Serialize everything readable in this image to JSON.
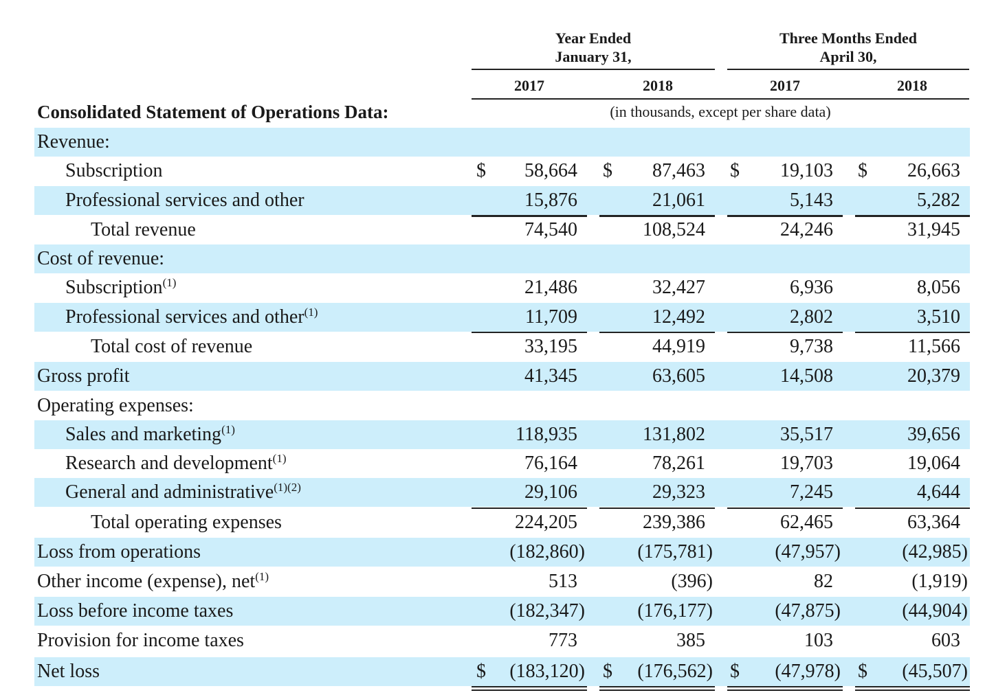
{
  "header": {
    "group1_line1": "Year Ended",
    "group1_line2": "January 31,",
    "group2_line1": "Three Months Ended",
    "group2_line2": "April 30,",
    "years": [
      "2017",
      "2018",
      "2017",
      "2018"
    ],
    "section_title": "Consolidated Statement of Operations Data:",
    "units_note": "(in thousands, except per share data)"
  },
  "rows": [
    {
      "label": "Revenue:",
      "note": "",
      "values": [
        "",
        "",
        "",
        ""
      ]
    },
    {
      "label": "Subscription",
      "note": "",
      "values": [
        "58,664",
        "87,463",
        "19,103",
        "26,663"
      ],
      "dollar": "$"
    },
    {
      "label": "Professional services and other",
      "note": "",
      "values": [
        "15,876",
        "21,061",
        "5,143",
        "5,282"
      ]
    },
    {
      "label": "Total revenue",
      "note": "",
      "values": [
        "74,540",
        "108,524",
        "24,246",
        "31,945"
      ]
    },
    {
      "label": "Cost of revenue:",
      "note": "",
      "values": [
        "",
        "",
        "",
        ""
      ]
    },
    {
      "label": "Subscription",
      "note": "(1)",
      "values": [
        "21,486",
        "32,427",
        "6,936",
        "8,056"
      ]
    },
    {
      "label": "Professional services and other",
      "note": "(1)",
      "values": [
        "11,709",
        "12,492",
        "2,802",
        "3,510"
      ]
    },
    {
      "label": "Total cost of revenue",
      "note": "",
      "values": [
        "33,195",
        "44,919",
        "9,738",
        "11,566"
      ]
    },
    {
      "label": "Gross profit",
      "note": "",
      "values": [
        "41,345",
        "63,605",
        "14,508",
        "20,379"
      ]
    },
    {
      "label": "Operating expenses:",
      "note": "",
      "values": [
        "",
        "",
        "",
        ""
      ]
    },
    {
      "label": "Sales and marketing",
      "note": "(1)",
      "values": [
        "118,935",
        "131,802",
        "35,517",
        "39,656"
      ]
    },
    {
      "label": "Research and development",
      "note": "(1)",
      "values": [
        "76,164",
        "78,261",
        "19,703",
        "19,064"
      ]
    },
    {
      "label": "General and administrative",
      "note": "(1)(2)",
      "values": [
        "29,106",
        "29,323",
        "7,245",
        "4,644"
      ]
    },
    {
      "label": "Total operating expenses",
      "note": "",
      "values": [
        "224,205",
        "239,386",
        "62,465",
        "63,364"
      ]
    },
    {
      "label": "Loss from operations",
      "note": "",
      "values": [
        "(182,860)",
        "(175,781)",
        "(47,957)",
        "(42,985)"
      ]
    },
    {
      "label": "Other income (expense), net",
      "note": "(1)",
      "values": [
        "513",
        "(396)",
        "82",
        "(1,919)"
      ]
    },
    {
      "label": "Loss before income taxes",
      "note": "",
      "values": [
        "(182,347)",
        "(176,177)",
        "(47,875)",
        "(44,904)"
      ]
    },
    {
      "label": "Provision for income taxes",
      "note": "",
      "values": [
        "773",
        "385",
        "103",
        "603"
      ]
    },
    {
      "label": "Net loss",
      "note": "",
      "values": [
        "(183,120)",
        "(176,562)",
        "(47,978)",
        "(45,507)"
      ],
      "dollar": "$"
    }
  ]
}
